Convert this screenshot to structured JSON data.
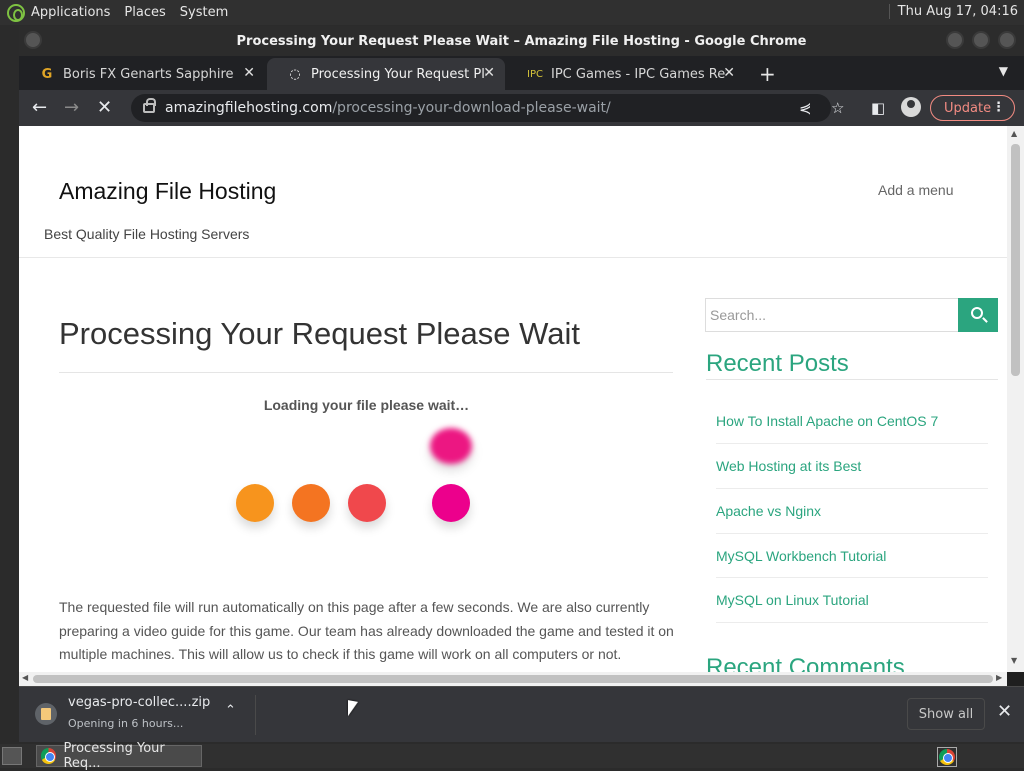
{
  "sysbar": {
    "menus": [
      "Applications",
      "Places",
      "System"
    ],
    "clock": "Thu Aug 17, 04:16"
  },
  "window": {
    "title": "Processing Your Request Please Wait – Amazing File Hosting - Google Chrome"
  },
  "tabs": [
    {
      "label": "Boris FX Genarts Sapphire Suite",
      "icon": "G"
    },
    {
      "label": "Processing Your Request Please Wait",
      "icon": "loading"
    },
    {
      "label": "IPC Games - IPC Games Review",
      "icon": "IPC"
    }
  ],
  "toolbar": {
    "url_domain": "amazingfilehosting.com",
    "url_path": "/processing-your-download-please-wait/",
    "update_label": "Update"
  },
  "page": {
    "site_title": "Amazing File Hosting",
    "add_menu": "Add a menu",
    "tagline": "Best Quality File Hosting Servers",
    "post_title": "Processing Your Request Please Wait",
    "loading_text": "Loading your file please wait…",
    "body_text": "The requested file will run automatically on this page after a few seconds. We are also currently preparing a video guide for this game. Our team has already downloaded the game and tested it on multiple machines. This will allow us to check if this game will work on all computers or not.",
    "loader_colors": [
      "#f7941d",
      "#f47421",
      "#f0484c",
      "#ec008c",
      "#ec1782"
    ]
  },
  "sidebar": {
    "search_placeholder": "Search...",
    "recent_posts_title": "Recent Posts",
    "recent_posts": [
      "How To Install Apache on CentOS 7",
      "Web Hosting at its Best",
      "Apache vs Nginx",
      "MySQL Workbench Tutorial",
      "MySQL on Linux Tutorial"
    ],
    "recent_comments_title": "Recent Comments",
    "accent": "#2ba57f"
  },
  "downloads": {
    "file_name": "vegas-pro-collec....zip",
    "status": "Opening in 6 hours...",
    "show_all": "Show all"
  },
  "taskbar": {
    "item_label": "Processing Your Req..."
  }
}
